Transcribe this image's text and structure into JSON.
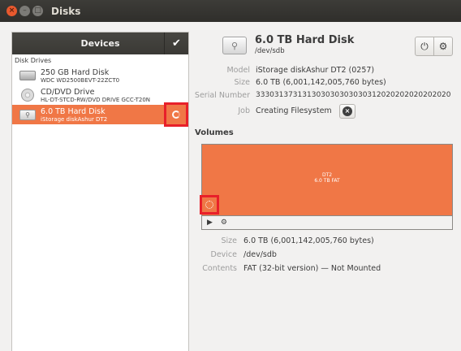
{
  "window": {
    "title": "Disks",
    "close_icon": "close-icon",
    "min_icon": "minimize-icon",
    "max_icon": "maximize-icon"
  },
  "sidebar": {
    "header": "Devices",
    "check_icon": "check-icon",
    "section_label": "Disk Drives",
    "drives": [
      {
        "name": "250 GB Hard Disk",
        "sub": "WDC WD2500BEVT-22ZCT0",
        "icon": "hard-disk-icon",
        "selected": false
      },
      {
        "name": "CD/DVD Drive",
        "sub": "HL-DT-STCD-RW/DVD DRIVE GCC-T20N",
        "icon": "optical-drive-icon",
        "selected": false
      },
      {
        "name": "6.0 TB Hard Disk",
        "sub": "iStorage diskAshur DT2",
        "icon": "usb-drive-icon",
        "selected": true
      }
    ]
  },
  "details": {
    "title": "6.0 TB Hard Disk",
    "device": "/dev/sdb",
    "power_icon": "power-icon",
    "settings_icon": "gear-icon",
    "props": [
      {
        "label": "Model",
        "value": "iStorage diskAshur DT2 (0257)"
      },
      {
        "label": "Size",
        "value": "6.0 TB (6,001,142,005,760 bytes)"
      },
      {
        "label": "Serial Number",
        "value": "333031373131303030303030312020202020202020"
      },
      {
        "label": "Job",
        "value": "Creating Filesystem"
      }
    ]
  },
  "volumes": {
    "header": "Volumes",
    "partition": {
      "name": "DT2",
      "size": "6.0 TB FAT",
      "color": "#f07746"
    },
    "toolbar": {
      "play_icon": "play-icon",
      "settings_icon": "gears-icon"
    },
    "props": [
      {
        "label": "Size",
        "value": "6.0 TB (6,001,142,005,760 bytes)"
      },
      {
        "label": "Device",
        "value": "/dev/sdb"
      },
      {
        "label": "Contents",
        "value": "FAT (32-bit version) — Not Mounted"
      }
    ]
  }
}
